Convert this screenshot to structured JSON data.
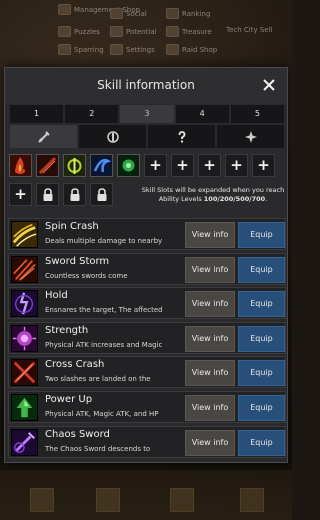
{
  "background_menu": [
    {
      "label": "Management Shop",
      "icon": "shop-icon"
    },
    {
      "label": "Social",
      "icon": "social-icon"
    },
    {
      "label": "Ranking",
      "icon": "ranking-icon"
    },
    {
      "label": "Puzzles",
      "icon": "puzzle-icon"
    },
    {
      "label": "Potential",
      "icon": "potential-icon"
    },
    {
      "label": "Treasure",
      "icon": "treasure-icon"
    },
    {
      "label": "Tech City Sell",
      "icon": ""
    },
    {
      "label": "Sparring",
      "icon": "sparring-icon"
    },
    {
      "label": "Settings",
      "icon": "settings-icon"
    },
    {
      "label": "Raid Shop",
      "icon": "raid-shop-icon"
    }
  ],
  "dialog": {
    "title": "Skill information",
    "close_icon": "close-icon"
  },
  "level_tabs": [
    {
      "label": "1",
      "active": false
    },
    {
      "label": "2",
      "active": false
    },
    {
      "label": "3",
      "active": true
    },
    {
      "label": "4",
      "active": false
    },
    {
      "label": "5",
      "active": false
    }
  ],
  "category_tabs": [
    {
      "icon": "sword-icon",
      "active": true
    },
    {
      "icon": "buff-icon",
      "active": false
    },
    {
      "icon": "question-icon",
      "active": false
    },
    {
      "icon": "compass-icon",
      "active": false
    }
  ],
  "slot_note": {
    "line1": "Skill Slots will be expanded when you reach",
    "line2_prefix": "Ability Levels ",
    "levels": "100/200/500/700",
    "line2_suffix": "."
  },
  "buttons": {
    "view": "View info",
    "equip": "Equip"
  },
  "skills": [
    {
      "name": "Spin Crash",
      "desc": "Deals multiple damage to nearby",
      "icon": "spin-crash-icon",
      "color": "#e8c233"
    },
    {
      "name": "Sword Storm",
      "desc": "Countless swords come",
      "icon": "sword-storm-icon",
      "color": "#d94a25"
    },
    {
      "name": "Hold",
      "desc": "Ensnares the target, The affected",
      "icon": "hold-icon",
      "color": "#8c4fd6"
    },
    {
      "name": "Strength",
      "desc": "Physical ATK increases and Magic",
      "icon": "strength-icon",
      "color": "#b544c9"
    },
    {
      "name": "Cross Crash",
      "desc": "Two slashes are landed on the",
      "icon": "cross-crash-icon",
      "color": "#d23b2b"
    },
    {
      "name": "Power Up",
      "desc": "Physical ATK, Magic ATK, and HP",
      "icon": "power-up-icon",
      "color": "#3fb84a"
    },
    {
      "name": "Chaos Sword",
      "desc": "The Chaos Sword descends to",
      "icon": "chaos-sword-icon",
      "color": "#a03ed6"
    }
  ],
  "equipped_slots": [
    {
      "icon": "fire-skill-icon",
      "color": "#c8321d"
    },
    {
      "icon": "slash-skill-icon",
      "color": "#8a2a1a"
    },
    {
      "icon": "buff-skill-icon",
      "color": "#a8c22a"
    },
    {
      "icon": "storm-skill-icon",
      "color": "#2a5fc2"
    },
    {
      "icon": "poison-skill-icon",
      "color": "#2aa84a"
    }
  ]
}
